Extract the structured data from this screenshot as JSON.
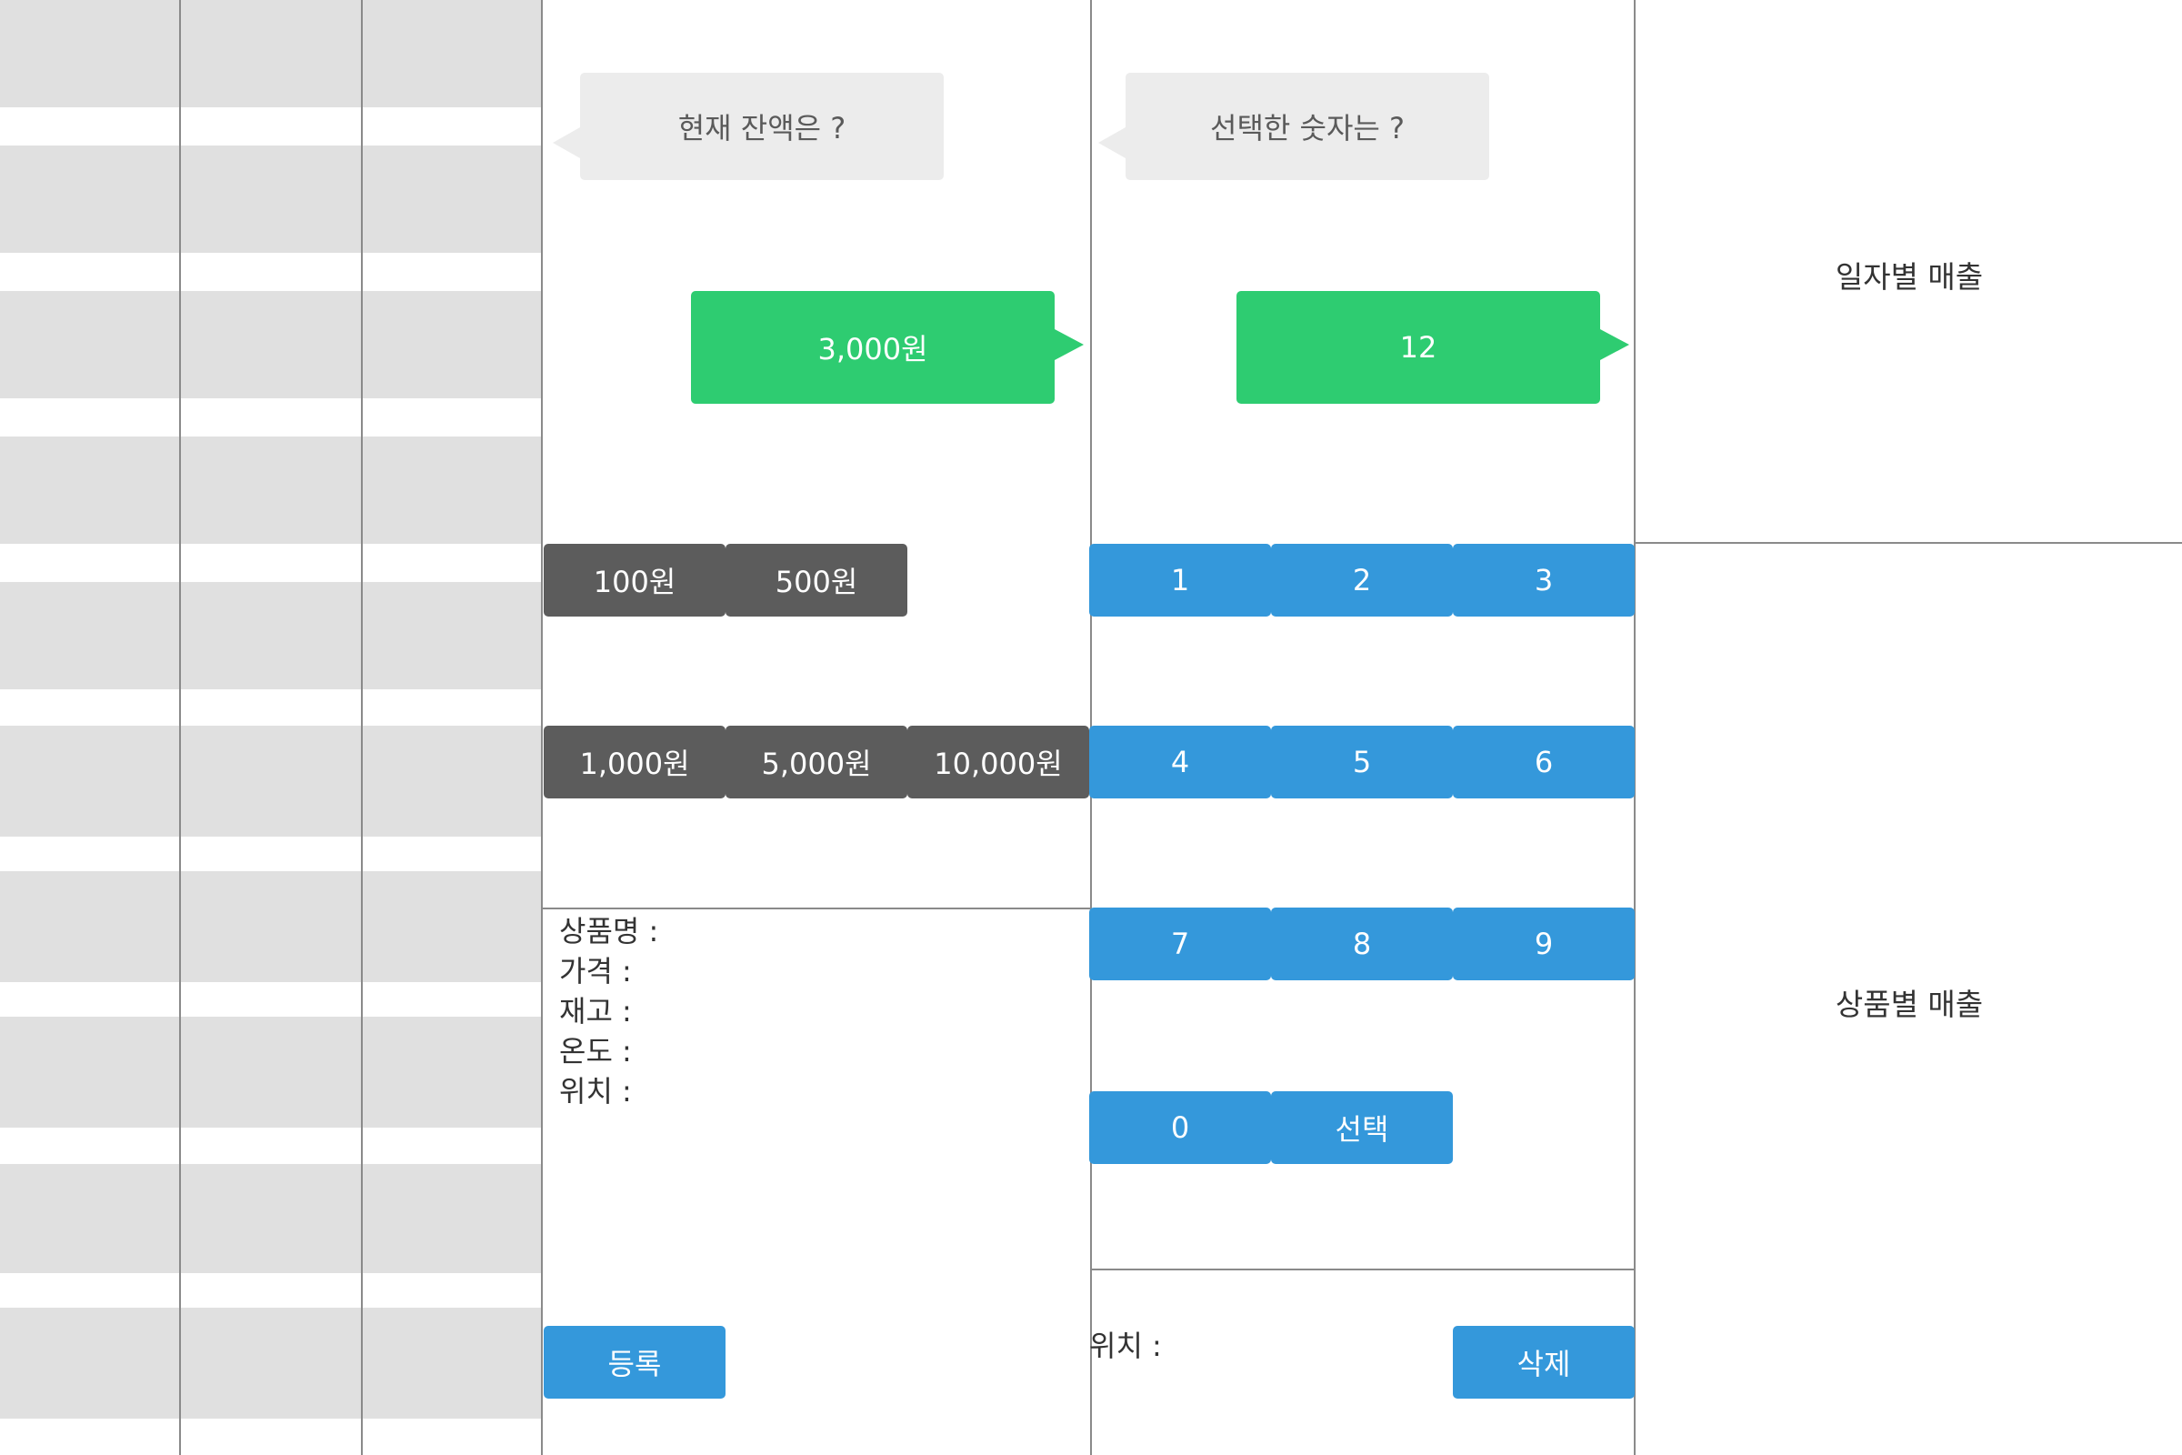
{
  "balance_panel": {
    "prompt": "현재 잔액은 ?",
    "amount": "3,000원",
    "coin_buttons": [
      "100원",
      "500원"
    ],
    "bill_buttons": [
      "1,000원",
      "5,000원",
      "10,000원"
    ]
  },
  "product_info": {
    "name_label": "상품명 :",
    "price_label": "가격 :",
    "stock_label": "재고 :",
    "temperature_label": "온도 :",
    "location_label": "위치 :",
    "register_label": "등록"
  },
  "number_panel": {
    "prompt": "선택한 숫자는 ?",
    "selected_value": "12",
    "keys": [
      "1",
      "2",
      "3",
      "4",
      "5",
      "6",
      "7",
      "8",
      "9",
      "0"
    ],
    "select_label": "선택",
    "location_label": "위치 :",
    "delete_label": "삭제"
  },
  "sales": {
    "daily_label": "일자별 매출",
    "product_label": "상품별 매출"
  },
  "colors": {
    "green_bubble": "#2ecc71",
    "blue_button": "#3498db",
    "dark_button": "#5c5c5c",
    "gray_bubble": "#ececec",
    "slot_gray": "#e0e0e0"
  }
}
